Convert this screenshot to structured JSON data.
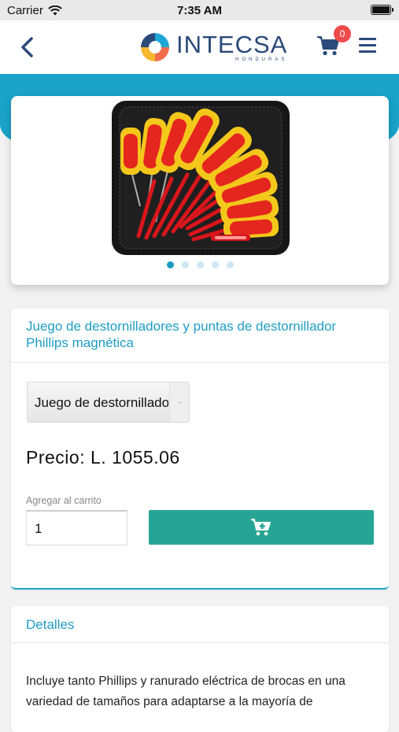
{
  "status_bar": {
    "carrier": "Carrier",
    "time": "7:35 AM"
  },
  "navbar": {
    "logo_main": "INTECSA",
    "logo_sub": "HONDURAS",
    "cart_count": "0",
    "icons": [
      "chevron-left-icon",
      "cart-icon",
      "hamburger-menu-icon"
    ]
  },
  "carousel": {
    "slides": 5,
    "active_index": 0
  },
  "product": {
    "title": "Juego de destornilladores y puntas de destornillador Phillips magnética",
    "variant_selected": "Juego de destornilladores y puntas",
    "price_text": "Precio: L. 1055.06",
    "qty_label": "Agregar al carrito",
    "qty_value": "1"
  },
  "details": {
    "title": "Detalles",
    "text": "Incluye tanto Phillips y ranurado eléctrica de brocas en una variedad de tamaños para adaptarse a la mayoría de"
  },
  "colors": {
    "accent_teal": "#1aa2c9",
    "button_green": "#27a594",
    "badge_red": "#ef4b4b",
    "brand_navy": "#2a4a7a"
  }
}
